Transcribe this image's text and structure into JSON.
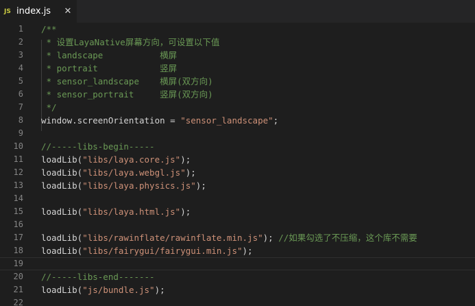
{
  "tab": {
    "icon": "JS",
    "title": "index.js",
    "close": "✕"
  },
  "colors": {
    "background": "#1e1e1e",
    "comment": "#6a9955",
    "string": "#ce9178",
    "plain": "#d4d4d4",
    "line_number": "#858585",
    "js_icon": "#cbcb41"
  },
  "lines": [
    {
      "n": "1",
      "tokens": [
        {
          "t": "/**",
          "k": "comment"
        }
      ]
    },
    {
      "n": "2",
      "tokens": [
        {
          "t": " * 设置LayaNative屏幕方向，可设置以下值",
          "k": "comment"
        }
      ]
    },
    {
      "n": "3",
      "tokens": [
        {
          "t": " * landscape           横屏",
          "k": "comment"
        }
      ]
    },
    {
      "n": "4",
      "tokens": [
        {
          "t": " * portrait            竖屏",
          "k": "comment"
        }
      ]
    },
    {
      "n": "5",
      "tokens": [
        {
          "t": " * sensor_landscape    横屏(双方向)",
          "k": "comment"
        }
      ]
    },
    {
      "n": "6",
      "tokens": [
        {
          "t": " * sensor_portrait     竖屏(双方向)",
          "k": "comment"
        }
      ]
    },
    {
      "n": "7",
      "tokens": [
        {
          "t": " */",
          "k": "comment"
        }
      ]
    },
    {
      "n": "8",
      "tokens": [
        {
          "t": "window.screenOrientation = ",
          "k": "plain"
        },
        {
          "t": "\"sensor_landscape\"",
          "k": "string"
        },
        {
          "t": ";",
          "k": "plain"
        }
      ]
    },
    {
      "n": "9",
      "tokens": []
    },
    {
      "n": "10",
      "tokens": [
        {
          "t": "//-----libs-begin-----",
          "k": "comment"
        }
      ]
    },
    {
      "n": "11",
      "tokens": [
        {
          "t": "loadLib(",
          "k": "plain"
        },
        {
          "t": "\"libs/laya.core.js\"",
          "k": "string"
        },
        {
          "t": ");",
          "k": "plain"
        }
      ]
    },
    {
      "n": "12",
      "tokens": [
        {
          "t": "loadLib(",
          "k": "plain"
        },
        {
          "t": "\"libs/laya.webgl.js\"",
          "k": "string"
        },
        {
          "t": ");",
          "k": "plain"
        }
      ]
    },
    {
      "n": "13",
      "tokens": [
        {
          "t": "loadLib(",
          "k": "plain"
        },
        {
          "t": "\"libs/laya.physics.js\"",
          "k": "string"
        },
        {
          "t": ");",
          "k": "plain"
        }
      ]
    },
    {
      "n": "14",
      "tokens": []
    },
    {
      "n": "15",
      "tokens": [
        {
          "t": "loadLib(",
          "k": "plain"
        },
        {
          "t": "\"libs/laya.html.js\"",
          "k": "string"
        },
        {
          "t": ");",
          "k": "plain"
        }
      ]
    },
    {
      "n": "16",
      "tokens": []
    },
    {
      "n": "17",
      "tokens": [
        {
          "t": "loadLib(",
          "k": "plain"
        },
        {
          "t": "\"libs/rawinflate/rawinflate.min.js\"",
          "k": "string"
        },
        {
          "t": "); ",
          "k": "plain"
        },
        {
          "t": "//如果勾选了不压缩，这个库不需要",
          "k": "comment"
        }
      ]
    },
    {
      "n": "18",
      "tokens": [
        {
          "t": "loadLib(",
          "k": "plain"
        },
        {
          "t": "\"libs/fairygui/fairygui.min.js\"",
          "k": "string"
        },
        {
          "t": ");",
          "k": "plain"
        }
      ]
    },
    {
      "n": "19",
      "tokens": [],
      "current": true
    },
    {
      "n": "20",
      "tokens": [
        {
          "t": "//-----libs-end-------",
          "k": "comment"
        }
      ]
    },
    {
      "n": "21",
      "tokens": [
        {
          "t": "loadLib(",
          "k": "plain"
        },
        {
          "t": "\"js/bundle.js\"",
          "k": "string"
        },
        {
          "t": ");",
          "k": "plain"
        }
      ]
    },
    {
      "n": "22",
      "tokens": []
    }
  ]
}
